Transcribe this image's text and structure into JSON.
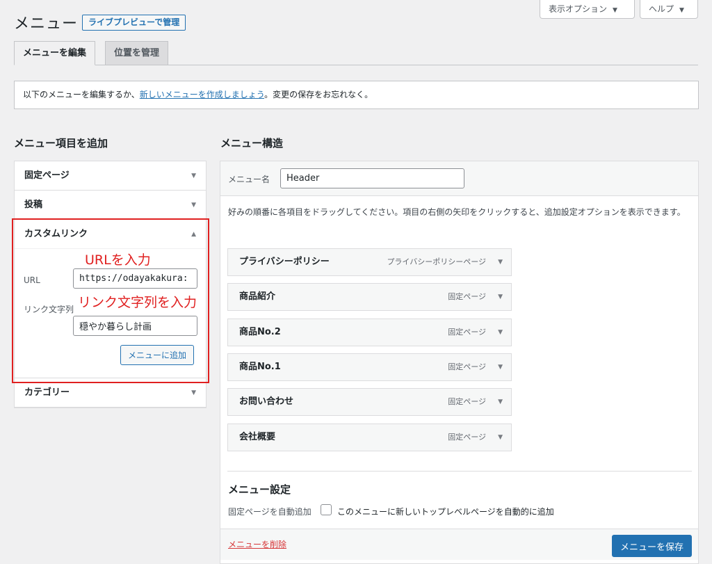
{
  "header": {
    "title": "メニュー",
    "live_preview": "ライブプレビューで管理",
    "screen_options": "表示オプション",
    "help": "ヘルプ"
  },
  "tabs": [
    {
      "label": "メニューを編集",
      "active": true
    },
    {
      "label": "位置を管理",
      "active": false
    }
  ],
  "notice": {
    "before": "以下のメニューを編集するか、",
    "link": "新しいメニューを作成しましょう",
    "after": "。変更の保存をお忘れなく。"
  },
  "add_items": {
    "heading": "メニュー項目を追加",
    "sections": [
      {
        "label": "固定ページ",
        "expanded": false
      },
      {
        "label": "投稿",
        "expanded": false
      },
      {
        "label": "カスタムリンク",
        "expanded": true
      },
      {
        "label": "カテゴリー",
        "expanded": false
      }
    ],
    "custom_link": {
      "url_label": "URL",
      "url_value": "https://odayakakura:",
      "text_label": "リンク文字列",
      "text_value": "穏やか暮らし計画",
      "add_button": "メニューに追加"
    }
  },
  "annotations": {
    "url_hint": "URLを入力",
    "text_hint": "リンク文字列を入力",
    "color": "#e02020"
  },
  "structure": {
    "heading": "メニュー構造",
    "menu_name_label": "メニュー名",
    "menu_name_value": "Header",
    "instructions": "好みの順番に各項目をドラッグしてください。項目の右側の矢印をクリックすると、追加設定オプションを表示できます。",
    "items": [
      {
        "title": "プライバシーポリシー",
        "type": "プライバシーポリシーページ"
      },
      {
        "title": "商品紹介",
        "type": "固定ページ"
      },
      {
        "title": "商品No.2",
        "type": "固定ページ"
      },
      {
        "title": "商品No.1",
        "type": "固定ページ"
      },
      {
        "title": "お問い合わせ",
        "type": "固定ページ"
      },
      {
        "title": "会社概要",
        "type": "固定ページ"
      }
    ],
    "settings": {
      "title": "メニュー設定",
      "auto_add_label": "固定ページを自動追加",
      "auto_add_option": "このメニューに新しいトップレベルページを自動的に追加",
      "auto_add_checked": false
    },
    "delete_link": "メニューを削除",
    "save_button": "メニューを保存"
  },
  "colors": {
    "accent": "#2271b1",
    "delete": "#d63638",
    "background": "#f0f0f1"
  }
}
